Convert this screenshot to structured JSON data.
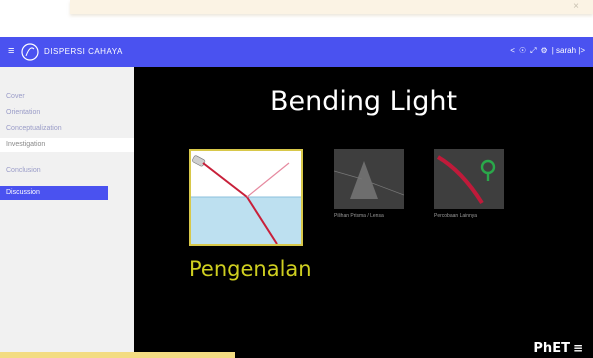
{
  "window": {
    "close_glyph": "×"
  },
  "header": {
    "menu_glyph": "≡",
    "title": "DISPERSI CAHAYA",
    "tools": [
      "<",
      "☉",
      "⤢",
      "⚙",
      "| sarah |>"
    ]
  },
  "sidebar": {
    "items": [
      {
        "label": "Cover",
        "state": "normal"
      },
      {
        "label": "Orientation",
        "state": "normal"
      },
      {
        "label": "Conceptualization",
        "state": "normal"
      },
      {
        "label": "Investigation",
        "state": "current"
      },
      {
        "label": "Conclusion",
        "state": "normal"
      },
      {
        "label": "Discussion",
        "state": "active"
      }
    ]
  },
  "sim": {
    "title": "Bending Light",
    "screens": [
      {
        "label": "Pengenalan",
        "selected": true
      },
      {
        "label": "Pilihan Prisma / Lensa",
        "selected": false
      },
      {
        "label": "Percobaan Lainnya",
        "selected": false
      }
    ],
    "brand": "PhET",
    "brand_menu_glyph": "≡"
  },
  "colors": {
    "header": "#4a52f0",
    "selected_border": "#d8c84a",
    "selected_label": "#cfcf20",
    "sidebar_bg": "#f1f1f1",
    "sim_bg": "#000000"
  }
}
